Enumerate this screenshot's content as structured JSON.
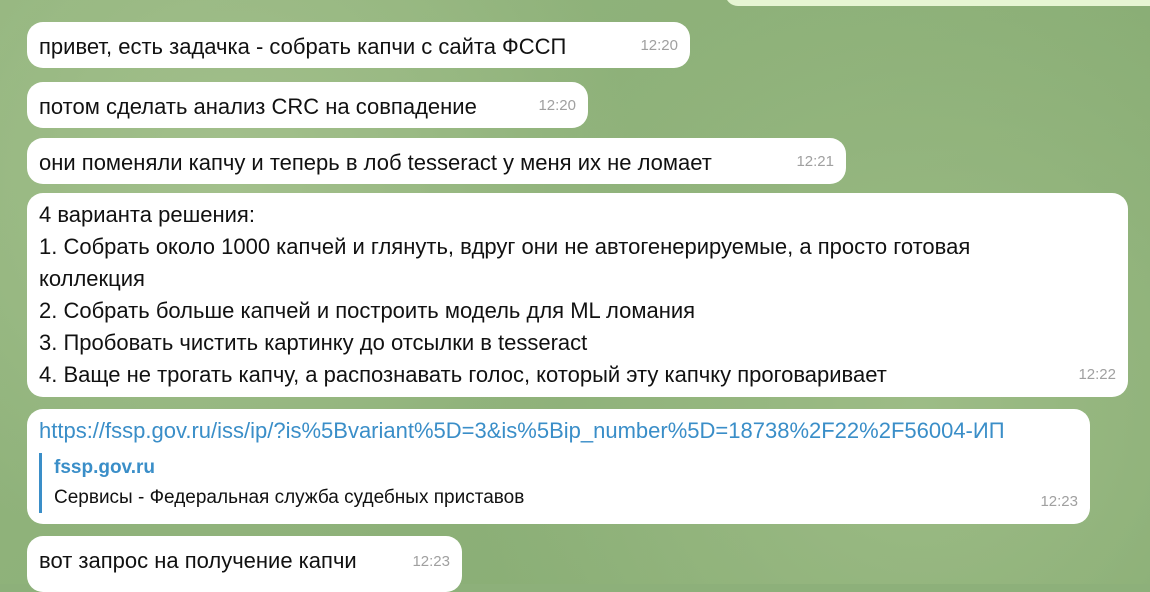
{
  "messages": [
    {
      "text": "привет, есть задачка - собрать капчи с сайта ФССП",
      "time": "12:20"
    },
    {
      "text": "потом сделать анализ CRC на совпадение",
      "time": "12:20"
    },
    {
      "text": "они поменяли капчу и теперь в лоб tesseract у меня их не ломает",
      "time": "12:21"
    },
    {
      "lines": [
        "4 варианта решения:",
        "1. Собрать около 1000 капчей и глянуть, вдруг они не автогенерируемые, а просто готовая",
        "коллекция",
        "2. Собрать больше капчей и построить модель для ML ломания",
        "3. Пробовать чистить картинку до отсылки в tesseract",
        "4. Ваще не трогать капчу, а распознавать голос, который эту капчку проговаривает"
      ],
      "time": "12:22"
    },
    {
      "link": "https://fssp.gov.ru/iss/ip/?is%5Bvariant%5D=3&is%5Bip_number%5D=18738%2F22%2F56004-ИП",
      "preview_site": "fssp.gov.ru",
      "preview_title": "Сервисы - Федеральная служба судебных приставов",
      "time": "12:23"
    },
    {
      "text": "вот запрос на получение капчи",
      "time": "12:23"
    }
  ]
}
